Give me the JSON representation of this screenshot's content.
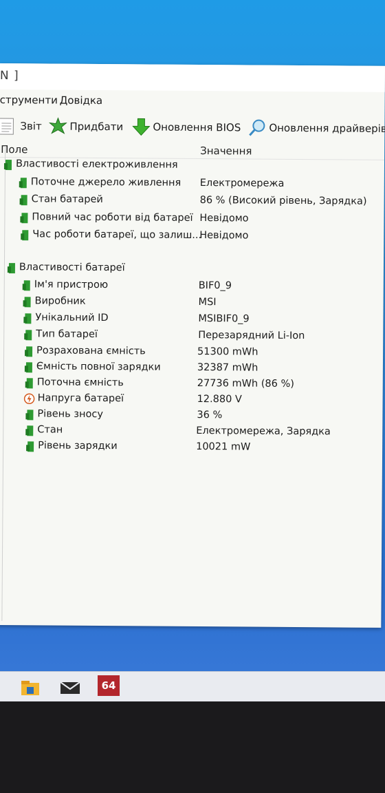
{
  "window": {
    "title_fragment": "N ]"
  },
  "menu": {
    "items": [
      "струменти",
      "Довідка"
    ]
  },
  "toolbar": {
    "report": "Звіт",
    "buy": "Придбати",
    "bios_update": "Оновлення BIOS",
    "driver_update": "Оновлення драйверів"
  },
  "list_header": {
    "field": "Поле",
    "value": "Значення"
  },
  "power_group": {
    "title": "Властивості електроживлення",
    "rows": [
      {
        "field": "Поточне джерело живлення",
        "value": "Електромережа"
      },
      {
        "field": "Стан батарей",
        "value": "86 % (Високий рівень, Зарядка)"
      },
      {
        "field": "Повний час роботи від батареї",
        "value": "Невідомо"
      },
      {
        "field": "Час роботи батареї, що залиш...",
        "value": "Невідомо"
      }
    ]
  },
  "battery_group": {
    "title": "Властивості батареї",
    "rows": [
      {
        "field": "Ім'я пристрою",
        "value": "BIF0_9"
      },
      {
        "field": "Виробник",
        "value": "MSI"
      },
      {
        "field": "Унікальний ID",
        "value": "MSIBIF0_9"
      },
      {
        "field": "Тип батареї",
        "value": "Перезарядний Li-Ion"
      },
      {
        "field": "Розрахована ємність",
        "value": "51300 mWh"
      },
      {
        "field": "Ємність повної зарядки",
        "value": "32387 mWh"
      },
      {
        "field": "Поточна ємність",
        "value": "27736 mWh  (86 %)"
      },
      {
        "field": "Напруга батареї",
        "value": "12.880 V"
      },
      {
        "field": "Рівень зносу",
        "value": "36 %"
      },
      {
        "field": "Стан",
        "value": "Електромережа, Зарядка"
      },
      {
        "field": "Рівень зарядки",
        "value": "10021 mW"
      }
    ]
  },
  "taskbar": {
    "app_badge": "64"
  },
  "colors": {
    "desktop": "#2b8ad8",
    "battery_icon": "#2e9a32",
    "voltage_icon": "#d45a1e"
  }
}
